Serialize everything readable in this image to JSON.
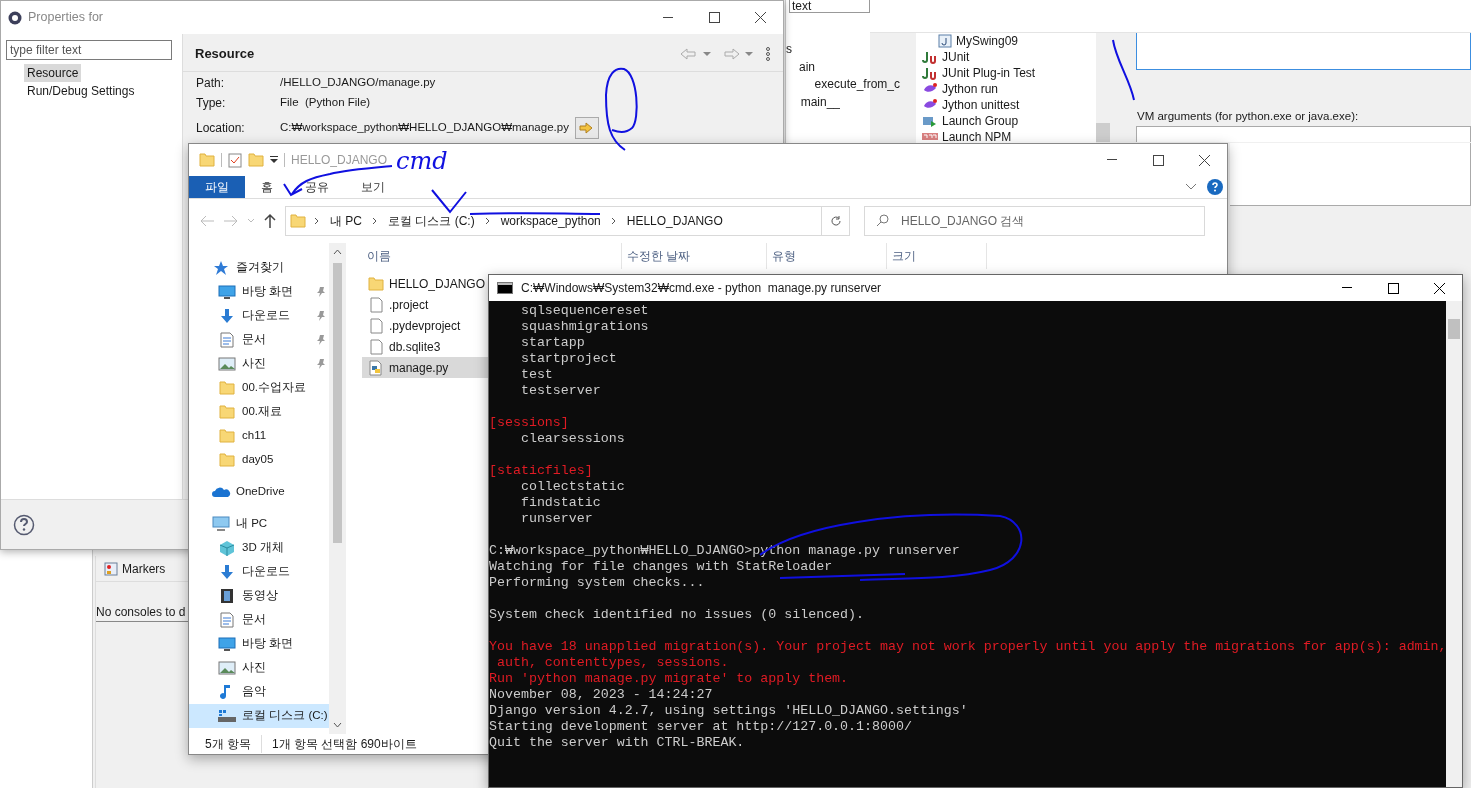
{
  "background_ide": {
    "filter_field_value": "text",
    "outline_items": [
      "s",
      "ain",
      "execute_from_c",
      "main__"
    ],
    "launch_configs": [
      {
        "label": "MySwing09",
        "kind": "java",
        "nested": true
      },
      {
        "label": "JUnit",
        "kind": "junit",
        "nested": false
      },
      {
        "label": "JUnit Plug-in Test",
        "kind": "junit",
        "nested": false
      },
      {
        "label": "Jython run",
        "kind": "jython",
        "nested": false
      },
      {
        "label": "Jython unittest",
        "kind": "jython",
        "nested": false
      },
      {
        "label": "Launch Group",
        "kind": "group",
        "nested": false
      },
      {
        "label": "Launch NPM",
        "kind": "npm",
        "nested": false
      }
    ],
    "vm_arguments_label": "VM arguments (for python.exe or java.exe):",
    "bottom_tabs": [
      {
        "label": "Markers"
      }
    ],
    "console_message": "No consoles to d"
  },
  "properties_dialog": {
    "title": "Properties for",
    "filter_placeholder": "type filter text",
    "tree": [
      {
        "label": "Resource",
        "selected": true
      },
      {
        "label": "Run/Debug Settings",
        "selected": false
      }
    ],
    "page_title": "Resource",
    "fields": [
      {
        "label": "Path:",
        "value": "/HELLO_DJANGO/manage.py",
        "kind": "text"
      },
      {
        "label": "Type:",
        "value": "File  (Python File)",
        "kind": "text"
      },
      {
        "label": "Location:",
        "value": "C:₩workspace_python₩HELLO_DJANGO₩manage.py",
        "kind": "location"
      }
    ]
  },
  "explorer": {
    "title": "HELLO_DJANGO",
    "ribbon_tabs": [
      {
        "label": "파일",
        "selected": true
      },
      {
        "label": "홈",
        "selected": false
      },
      {
        "label": "공유",
        "selected": false
      },
      {
        "label": "보기",
        "selected": false
      }
    ],
    "breadcrumbs": [
      "내 PC",
      "로컬 디스크 (C:)",
      "workspace_python",
      "HELLO_DJANGO"
    ],
    "search_placeholder": "HELLO_DJANGO 검색",
    "nav": [
      {
        "label": "즐겨찾기",
        "kind": "star",
        "selected": false,
        "children": [
          {
            "label": "바탕 화면",
            "kind": "desktop",
            "pinned": true,
            "selected": false
          },
          {
            "label": "다운로드",
            "kind": "download",
            "pinned": true,
            "selected": false
          },
          {
            "label": "문서",
            "kind": "document",
            "pinned": true,
            "selected": false
          },
          {
            "label": "사진",
            "kind": "picture",
            "pinned": true,
            "selected": false
          },
          {
            "label": "00.수업자료",
            "kind": "folder",
            "pinned": false,
            "selected": false
          },
          {
            "label": "00.재료",
            "kind": "folder",
            "pinned": false,
            "selected": false
          },
          {
            "label": "ch11",
            "kind": "folder",
            "pinned": false,
            "selected": false
          },
          {
            "label": "day05",
            "kind": "folder",
            "pinned": false,
            "selected": false
          }
        ]
      },
      {
        "label": "OneDrive",
        "kind": "cloud",
        "selected": false
      },
      {
        "label": "내 PC",
        "kind": "pc",
        "selected": false,
        "children": [
          {
            "label": "3D 개체",
            "kind": "cube",
            "pinned": false,
            "selected": false
          },
          {
            "label": "다운로드",
            "kind": "download",
            "pinned": false,
            "selected": false
          },
          {
            "label": "동영상",
            "kind": "video",
            "pinned": false,
            "selected": false
          },
          {
            "label": "문서",
            "kind": "document",
            "pinned": false,
            "selected": false
          },
          {
            "label": "바탕 화면",
            "kind": "desktop",
            "pinned": false,
            "selected": false
          },
          {
            "label": "사진",
            "kind": "picture",
            "pinned": false,
            "selected": false
          },
          {
            "label": "음악",
            "kind": "music",
            "pinned": false,
            "selected": false
          },
          {
            "label": "로컬 디스크 (C:)",
            "kind": "drive",
            "pinned": false,
            "selected": true
          }
        ]
      }
    ],
    "columns": [
      "이름",
      "수정한 날짜",
      "유형",
      "크기"
    ],
    "files": [
      {
        "name": "HELLO_DJANGO",
        "kind": "folder",
        "selected": false
      },
      {
        "name": ".project",
        "kind": "file",
        "selected": false
      },
      {
        "name": ".pydevproject",
        "kind": "file",
        "selected": false
      },
      {
        "name": "db.sqlite3",
        "kind": "file",
        "selected": false
      },
      {
        "name": "manage.py",
        "kind": "python",
        "selected": true
      }
    ],
    "status_items": [
      "5개 항목",
      "1개 항목 선택함 690바이트"
    ]
  },
  "console": {
    "title": "C:₩Windows₩System32₩cmd.exe - python  manage.py runserver",
    "lines": [
      {
        "kind": "normal",
        "text": "    sqlsequencereset"
      },
      {
        "kind": "normal",
        "text": "    squashmigrations"
      },
      {
        "kind": "normal",
        "text": "    startapp"
      },
      {
        "kind": "normal",
        "text": "    startproject"
      },
      {
        "kind": "normal",
        "text": "    test"
      },
      {
        "kind": "normal",
        "text": "    testserver"
      },
      {
        "kind": "blank"
      },
      {
        "kind": "error",
        "text": "[sessions]"
      },
      {
        "kind": "normal",
        "text": "    clearsessions"
      },
      {
        "kind": "blank"
      },
      {
        "kind": "error",
        "text": "[staticfiles]"
      },
      {
        "kind": "normal",
        "text": "    collectstatic"
      },
      {
        "kind": "normal",
        "text": "    findstatic"
      },
      {
        "kind": "normal",
        "text": "    runserver"
      },
      {
        "kind": "blank"
      },
      {
        "kind": "normal",
        "text": "C:₩workspace_python₩HELLO_DJANGO>python manage.py runserver"
      },
      {
        "kind": "normal",
        "text": "Watching for file changes with StatReloader"
      },
      {
        "kind": "normal",
        "text": "Performing system checks..."
      },
      {
        "kind": "blank"
      },
      {
        "kind": "normal",
        "text": "System check identified no issues (0 silenced)."
      },
      {
        "kind": "blank"
      },
      {
        "kind": "error",
        "text": "You have 18 unapplied migration(s). Your project may not work properly until you apply the migrations for app(s): admin,"
      },
      {
        "kind": "error",
        "text": " auth, contenttypes, sessions."
      },
      {
        "kind": "error",
        "text": "Run 'python manage.py migrate' to apply them."
      },
      {
        "kind": "normal",
        "text": "November 08, 2023 - 14:24:27"
      },
      {
        "kind": "normal",
        "text": "Django version 4.2.7, using settings 'HELLO_DJANGO.settings'"
      },
      {
        "kind": "normal",
        "text": "Starting development server at http://127.0.0.1:8000/"
      },
      {
        "kind": "normal",
        "text": "Quit the server with CTRL-BREAK."
      }
    ]
  },
  "annotation": {
    "handwriting": "cmd"
  }
}
